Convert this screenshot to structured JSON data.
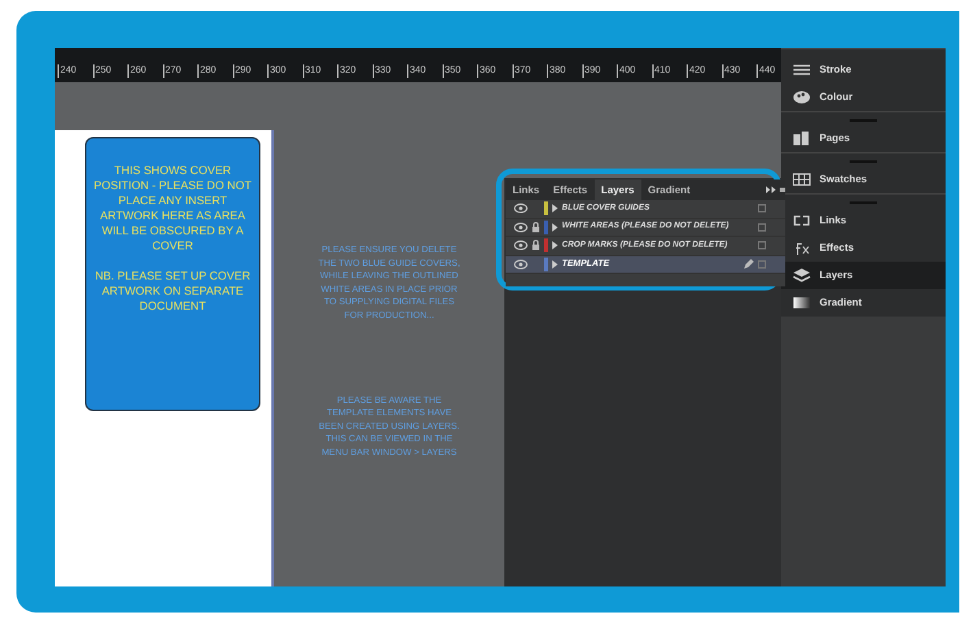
{
  "ruler": {
    "ticks": [
      "240",
      "250",
      "260",
      "270",
      "280",
      "290",
      "300",
      "310",
      "320",
      "330",
      "340",
      "350",
      "360",
      "370",
      "380",
      "390",
      "400",
      "410",
      "420",
      "430",
      "440"
    ]
  },
  "cover_note": {
    "paragraphs": [
      "THIS SHOWS COVER POSITION - PLEASE DO NOT PLACE ANY INSERT ARTWORK HERE AS AREA WILL BE OBSCURED BY A COVER",
      "NB. PLEASE SET UP COVER ARTWORK ON SEPARATE DOCUMENT"
    ]
  },
  "notes": [
    "PLEASE ENSURE YOU DELETE THE TWO BLUE GUIDE COVERS, WHILE LEAVING THE OUTLINED WHITE AREAS IN PLACE PRIOR TO SUPPLYING DIGITAL FILES FOR PRODUCTION...",
    "PLEASE BE AWARE THE TEMPLATE ELEMENTS HAVE BEEN CREATED USING LAYERS. THIS CAN BE VIEWED IN THE MENU BAR WINDOW > LAYERS"
  ],
  "layers_panel": {
    "tabs": [
      {
        "label": "Links",
        "selected": false
      },
      {
        "label": "Effects",
        "selected": false
      },
      {
        "label": "Layers",
        "selected": true
      },
      {
        "label": "Gradient",
        "selected": false
      }
    ],
    "layers": [
      {
        "name": "BLUE COVER GUIDES",
        "color": "#c8c040",
        "visible": true,
        "locked": false,
        "selected": false
      },
      {
        "name": "WHITE AREAS (PLEASE DO NOT DELETE)",
        "color": "#3a5fb0",
        "visible": true,
        "locked": true,
        "selected": false
      },
      {
        "name": "CROP MARKS (PLEASE DO NOT DELETE)",
        "color": "#c03030",
        "visible": true,
        "locked": true,
        "selected": false
      },
      {
        "name": "TEMPLATE",
        "color": "#5a7ac0",
        "visible": true,
        "locked": false,
        "selected": true
      }
    ]
  },
  "dock": {
    "groups": [
      [
        {
          "label": "Stroke",
          "kind": "stroke",
          "selected": false
        },
        {
          "label": "Colour",
          "kind": "colour",
          "selected": false
        }
      ],
      [
        {
          "label": "Pages",
          "kind": "pages",
          "selected": false
        }
      ],
      [
        {
          "label": "Swatches",
          "kind": "swatches",
          "selected": false
        }
      ],
      [
        {
          "label": "Links",
          "kind": "links",
          "selected": false
        },
        {
          "label": "Effects",
          "kind": "effects",
          "selected": false
        },
        {
          "label": "Layers",
          "kind": "layers",
          "selected": true
        },
        {
          "label": "Gradient",
          "kind": "gradient",
          "selected": false
        }
      ]
    ]
  }
}
